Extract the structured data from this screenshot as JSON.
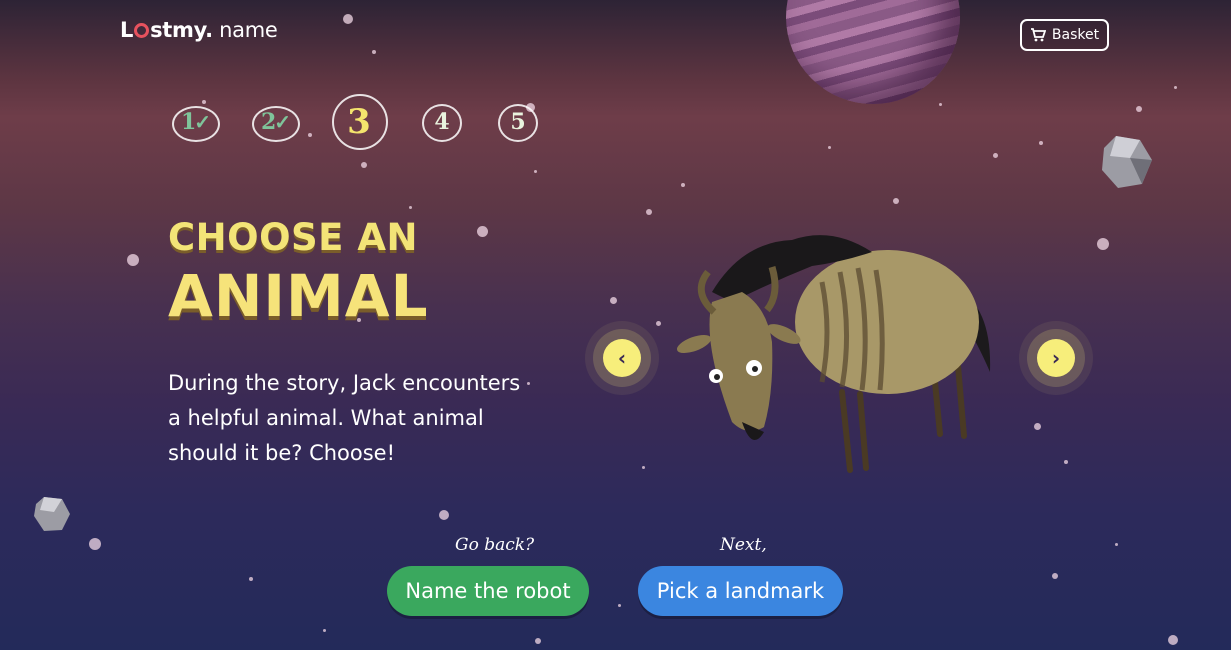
{
  "header": {
    "logo_brand_l": "L",
    "logo_brand_rest": "stmy.",
    "logo_name": " name",
    "basket_label": "Basket"
  },
  "steps": [
    {
      "label": "1",
      "state": "done"
    },
    {
      "label": "2",
      "state": "done"
    },
    {
      "label": "3",
      "state": "active"
    },
    {
      "label": "4",
      "state": "pending"
    },
    {
      "label": "5",
      "state": "pending"
    }
  ],
  "main": {
    "heading_line1": "CHOOSE AN",
    "heading_line2": "ANIMAL",
    "description": "During the story, Jack encounters a helpful animal. What animal should it be? Choose!",
    "prev_arrow": "‹",
    "next_arrow": "›"
  },
  "nav": {
    "back_hint": "Go back?",
    "back_button": "Name the robot",
    "next_hint": "Next,",
    "next_button": "Pick a landmark"
  },
  "colors": {
    "accent_yellow": "#f6e37a",
    "back_button": "#3aa85e",
    "next_button": "#3b86e0"
  }
}
